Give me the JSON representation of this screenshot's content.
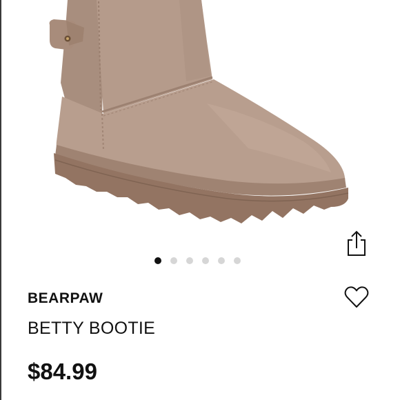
{
  "product": {
    "brand": "BEARPAW",
    "name": "BETTY BOOTIE",
    "price": "$84.99"
  },
  "gallery": {
    "image_subject": "tan suede boot",
    "dot_count": 6,
    "active_index": 0
  },
  "icons": {
    "share": "share-icon",
    "favorite": "heart-icon"
  },
  "colors": {
    "suede": "#b49a8a",
    "sole": "#967866",
    "dot_active": "#111111",
    "dot_inactive": "#d6d6d6",
    "text": "#111111"
  }
}
